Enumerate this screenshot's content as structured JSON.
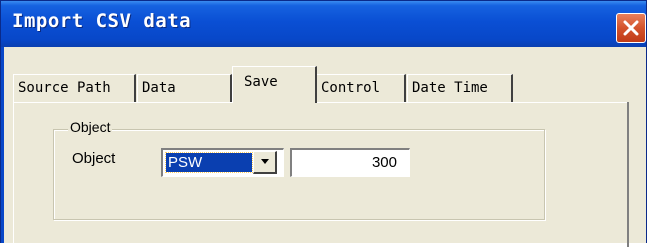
{
  "window": {
    "title": "Import CSV data",
    "close_icon": "close-icon",
    "colors": {
      "titlebar": "#0a4fd4",
      "close": "#d4532c",
      "selection": "#0a3fb0",
      "face": "#ece9d8"
    }
  },
  "tabs": [
    {
      "label": "Source Path",
      "active": false
    },
    {
      "label": "Data",
      "active": false
    },
    {
      "label": "Save",
      "active": true
    },
    {
      "label": "Control",
      "active": false
    },
    {
      "label": "Date Time",
      "active": false
    }
  ],
  "group": {
    "legend": "Object",
    "field_label": "Object",
    "select_value": "PSW",
    "select_arrow_icon": "chevron-down-icon",
    "number_value": "300"
  }
}
